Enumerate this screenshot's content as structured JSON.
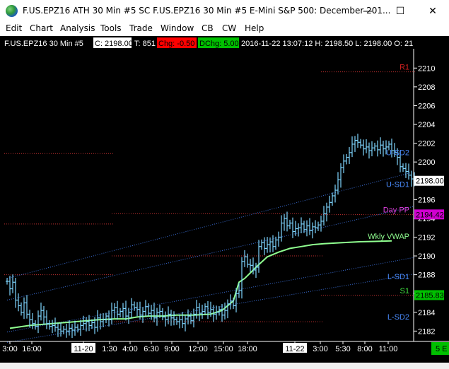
{
  "window": {
    "title": "F.US.EPZ16 ATH 30 Min #5  SC F.US.EPZ16  30 Min  #5  E-Mini S&P 500: December 201...",
    "minimize_glyph": "—",
    "maximize_glyph": "☐",
    "close_glyph": "✕"
  },
  "menu": [
    "Edit",
    "Chart",
    "Analysis",
    "Tools",
    "Trade",
    "Window",
    "CB",
    "CW",
    "Help"
  ],
  "chart_header": {
    "symbol": "F.US.EPZ16  30 Min   #5",
    "close": "C: 2198.00",
    "trades": "T: 851",
    "chg": "Chg: -0.50",
    "dchg": "DChg: 5.00",
    "rest": "2016-11-22  13:07:12  H: 2198.50  L: 2198.00  O: 21"
  },
  "colors": {
    "background": "#000000",
    "price_bar": "#7fd6ff",
    "pivot_line": "#c03030",
    "sd_line": "#3a6fd8",
    "vwap": "#90ff90",
    "chg_bg": "#ff0000",
    "dchg_bg": "#00c000",
    "daypp_bg": "#d000d0",
    "s1_bg": "#00c000"
  },
  "chart_data": {
    "type": "ohlc",
    "ylim": [
      2181.5,
      2211
    ],
    "yticks": [
      2182,
      2184,
      2186,
      2188,
      2190,
      2192,
      2194,
      2196,
      2198,
      2200,
      2202,
      2204,
      2206,
      2208,
      2210
    ],
    "xticks": [
      "3:00",
      "16:00",
      "11-20",
      "1:30",
      "4:00",
      "6:30",
      "9:00",
      "12:00",
      "15:00",
      "18:00",
      "11-22",
      "3:00",
      "5:30",
      "8:00",
      "11:00"
    ],
    "current_price": "2198.00",
    "level_labels": [
      {
        "name": "R1",
        "value": 2209.6
      },
      {
        "name": "U-SD2",
        "value": 2200.5
      },
      {
        "name": "U-SD1",
        "value": 2197.1
      },
      {
        "name": "Day PP",
        "value": 2194.4,
        "marker": "2194.42"
      },
      {
        "name": "Wkly VWAP",
        "value": 2191.6
      },
      {
        "name": "L-SD1",
        "value": 2187.3
      },
      {
        "name": "S1",
        "value": 2185.8,
        "marker": "2185.83"
      },
      {
        "name": "L-SD2",
        "value": 2183.0
      }
    ],
    "pivot_levels": [
      {
        "value": 2200.9,
        "from": 0,
        "to": 37
      },
      {
        "value": 2193.4,
        "from": 0,
        "to": 37
      },
      {
        "value": 2188.0,
        "from": 0,
        "to": 37
      },
      {
        "value": 2194.5,
        "from": 38,
        "to": 111
      },
      {
        "value": 2190.0,
        "from": 38,
        "to": 111
      },
      {
        "value": 2183.0,
        "from": 38,
        "to": 111
      },
      {
        "value": 2209.6,
        "from": 112,
        "to": 144
      },
      {
        "value": 2194.4,
        "from": 112,
        "to": 144
      },
      {
        "value": 2185.8,
        "from": 112,
        "to": 144
      }
    ],
    "price": [
      2187.3,
      2186.5,
      2187.2,
      2185.3,
      2184.7,
      2184.0,
      2185.0,
      2183.8,
      2183.2,
      2182.8,
      2182.5,
      2183.6,
      2184.2,
      2183.5,
      2182.8,
      2182.5,
      2182.6,
      2182.4,
      2182.2,
      2182.0,
      2182.2,
      2182.0,
      2182.3,
      2182.1,
      2182.4,
      2182.2,
      2182.6,
      2182.8,
      2183.0,
      2182.6,
      2182.9,
      2182.4,
      2183.4,
      2183.0,
      2183.2,
      2183.6,
      2183.2,
      2184.2,
      2184.5,
      2183.8,
      2184.1,
      2184.4,
      2183.6,
      2184.0,
      2184.8,
      2184.5,
      2184.3,
      2183.7,
      2184.1,
      2184.6,
      2183.9,
      2184.2,
      2183.4,
      2184.0,
      2184.1,
      2183.5,
      2183.2,
      2183.8,
      2183.4,
      2183.2,
      2183.0,
      2183.2,
      2182.8,
      2183.3,
      2183.6,
      2183.1,
      2183.8,
      2184.5,
      2183.9,
      2184.1,
      2184.6,
      2184.0,
      2184.3,
      2183.8,
      2184.0,
      2184.3,
      2183.7,
      2184.2,
      2184.9,
      2185.2,
      2184.7,
      2186.0,
      2186.3,
      2189.4,
      2189.9,
      2189.1,
      2189.0,
      2188.5,
      2188.8,
      2191.0,
      2191.4,
      2190.8,
      2191.2,
      2191.5,
      2191.0,
      2191.7,
      2192.0,
      2193.5,
      2194.0,
      2193.2,
      2193.5,
      2192.6,
      2192.9,
      2193.0,
      2193.4,
      2192.8,
      2193.2,
      2192.7,
      2193.1,
      2193.0,
      2193.3,
      2193.7,
      2194.5,
      2195.2,
      2195.7,
      2196.4,
      2197.0,
      2198.1,
      2199.4,
      2200.1,
      2200.5,
      2201.0,
      2201.9,
      2202.3,
      2202.1,
      2201.8,
      2201.4,
      2201.6,
      2201.2,
      2201.5,
      2201.7,
      2201.3,
      2201.8,
      2201.4,
      2201.6,
      2201.9,
      2201.2,
      2201.0,
      2200.5,
      2199.5,
      2199.3,
      2199.0,
      2198.6,
      2198.2,
      2198.0
    ],
    "vwap": [
      [
        1,
        2182.3
      ],
      [
        8,
        2182.6
      ],
      [
        16,
        2182.8
      ],
      [
        24,
        2183.0
      ],
      [
        32,
        2183.2
      ],
      [
        38,
        2183.3
      ],
      [
        42,
        2183.3
      ],
      [
        46,
        2183.5
      ],
      [
        50,
        2183.6
      ],
      [
        55,
        2183.6
      ],
      [
        60,
        2183.7
      ],
      [
        66,
        2183.7
      ],
      [
        72,
        2183.8
      ],
      [
        76,
        2184.2
      ],
      [
        80,
        2185.2
      ],
      [
        82,
        2187.2
      ],
      [
        84,
        2187.6
      ],
      [
        86,
        2188.2
      ],
      [
        88,
        2188.8
      ],
      [
        92,
        2189.9
      ],
      [
        96,
        2190.4
      ],
      [
        100,
        2190.8
      ],
      [
        104,
        2191.0
      ],
      [
        108,
        2191.2
      ],
      [
        112,
        2191.3
      ],
      [
        118,
        2191.4
      ],
      [
        124,
        2191.5
      ],
      [
        130,
        2191.55
      ],
      [
        136,
        2191.6
      ]
    ]
  }
}
